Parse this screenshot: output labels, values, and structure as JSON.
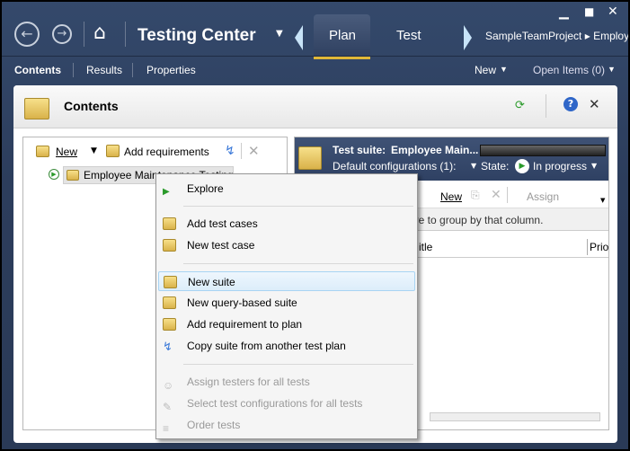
{
  "window": {
    "minimize": "▁",
    "maximize": "■",
    "close": "✕"
  },
  "header": {
    "title": "Testing Center",
    "tabs": [
      {
        "label": "Plan",
        "active": true
      },
      {
        "label": "Test",
        "active": false
      }
    ],
    "breadcrumb": "SampleTeamProject ▸ Employ"
  },
  "subnav": {
    "items": [
      "Contents",
      "Results",
      "Properties"
    ],
    "new_label": "New",
    "open_items": "Open Items (0)"
  },
  "panel": {
    "title": "Contents"
  },
  "left": {
    "toolbar": {
      "new_label": "New",
      "add_requirements": "Add requirements"
    },
    "tree_item": "Employee Maintenance Testing"
  },
  "right": {
    "suite_label": "Test suite:",
    "suite_name": "Employee Main...",
    "default_configs": "Default configurations (1):",
    "state_label": "State:",
    "state_value": "In progress",
    "toolbar": {
      "new_label": "New",
      "assign_label": "Assign"
    },
    "group_hint": "ere to group by that column.",
    "columns": [
      "itle",
      "Prio"
    ]
  },
  "menu": {
    "items": [
      {
        "label": "Explore",
        "disabled": false
      },
      {
        "label": "Add test cases",
        "disabled": false
      },
      {
        "label": "New test case",
        "disabled": false
      },
      {
        "label": "New suite",
        "disabled": false,
        "highlighted": true
      },
      {
        "label": "New query-based suite",
        "disabled": false
      },
      {
        "label": "Add requirement to plan",
        "disabled": false
      },
      {
        "label": "Copy suite from another test plan",
        "disabled": false
      },
      {
        "label": "Assign testers for all tests",
        "disabled": true
      },
      {
        "label": "Select test configurations for all tests",
        "disabled": true
      },
      {
        "label": "Order tests",
        "disabled": true
      }
    ]
  },
  "colors": {
    "accent": "#e8b830",
    "header_bg": "#2c3d5c",
    "highlight": "#dcedfa"
  }
}
